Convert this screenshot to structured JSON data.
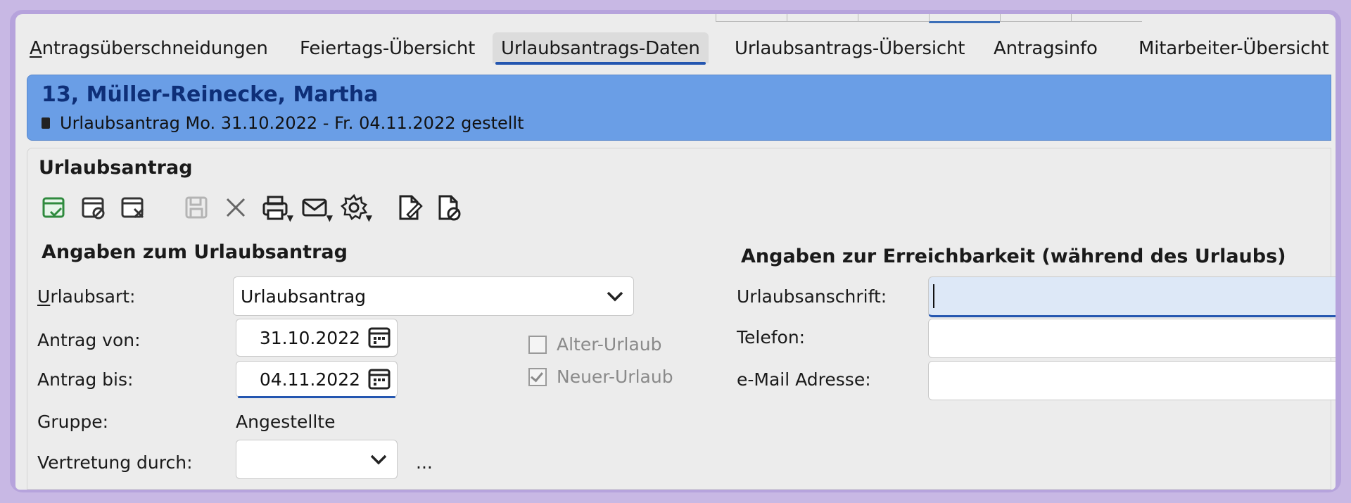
{
  "tabs": [
    {
      "label": "Antragsüberschneidungen",
      "active": false
    },
    {
      "label": "Feiertags-Übersicht",
      "active": false
    },
    {
      "label": "Urlaubsantrags-Daten",
      "active": true
    },
    {
      "label": "Urlaubsantrags-Übersicht",
      "active": false
    },
    {
      "label": "Antragsinfo",
      "active": false
    },
    {
      "label": "Mitarbeiter-Übersicht",
      "active": false
    }
  ],
  "header": {
    "name": "13, Müller-Reinecke, Martha",
    "status": "Urlaubsantrag Mo. 31.10.2022 - Fr. 04.11.2022 gestellt",
    "color": "#6a9ee6"
  },
  "panel": {
    "title": "Urlaubsantrag",
    "toolbar": [
      "calendar-check-icon",
      "calendar-block-icon",
      "calendar-delete-icon",
      "save-icon",
      "close-icon",
      "print-icon",
      "mail-icon",
      "gear-icon",
      "document-edit-icon",
      "document-block-icon"
    ]
  },
  "request": {
    "heading": "Angaben zum Urlaubsantrag",
    "type_label": "Urlaubsart:",
    "type_value": "Urlaubsantrag",
    "from_label": "Antrag von:",
    "from_value": "31.10.2022",
    "to_label": "Antrag bis:",
    "to_value": "04.11.2022",
    "group_label": "Gruppe:",
    "group_value": "Angestellte",
    "deputy_label": "Vertretung durch:",
    "deputy_value": "",
    "more_label": "...",
    "old_vacation_label": "Alter-Urlaub",
    "old_vacation_checked": false,
    "new_vacation_label": "Neuer-Urlaub",
    "new_vacation_checked": true
  },
  "contact": {
    "heading": "Angaben zur Erreichbarkeit (während des Urlaubs)",
    "address_label": "Urlaubsanschrift:",
    "address_value": "",
    "phone_label": "Telefon:",
    "phone_value": "",
    "email_label": "e-Mail Adresse:",
    "email_value": ""
  }
}
